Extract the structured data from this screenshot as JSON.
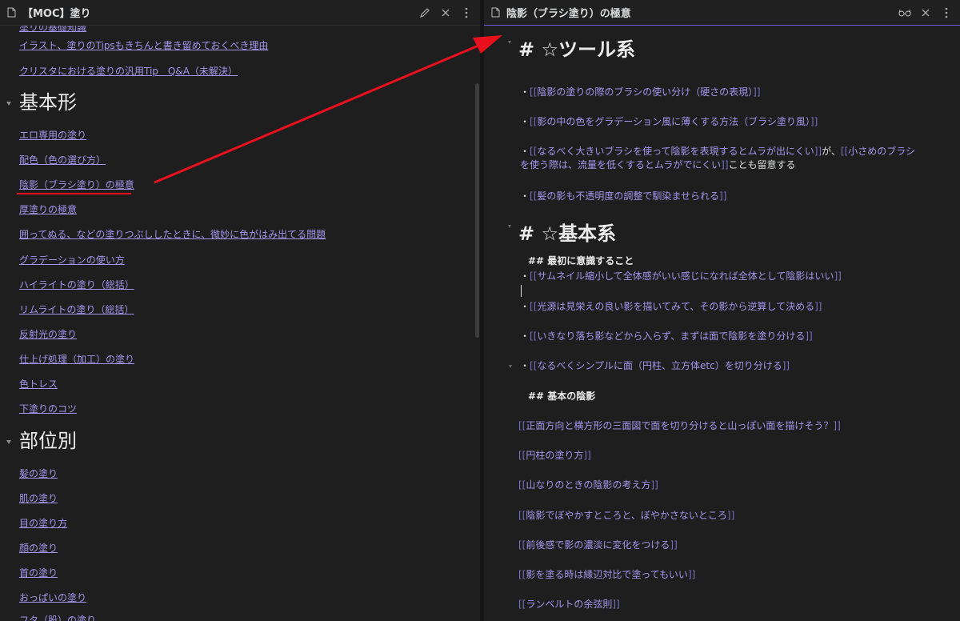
{
  "left_pane": {
    "title": "【MOC】塗り",
    "partial_top_link": "塗りの基礎知識",
    "intro_links": [
      "イラスト、塗りのTipsもきちんと書き留めておくべき理由",
      "クリスタにおける塗りの汎用Tip　Q&A（未解決）"
    ],
    "sections": [
      {
        "heading": "基本形",
        "links": [
          "エロ専用の塗り",
          "配色（色の選び方）",
          "陰影（ブラシ塗り）の極意",
          "厚塗りの極意",
          "囲ってぬる、などの塗りつぶししたときに、微妙に色がはみ出てる問題",
          "グラデーションの使い方",
          "ハイライトの塗り（総括）",
          "リムライトの塗り（総括）",
          "反射光の塗り",
          "仕上げ処理（加工）の塗り",
          "色トレス",
          "下塗りのコツ"
        ]
      },
      {
        "heading": "部位別",
        "links": [
          "髪の塗り",
          "肌の塗り",
          "目の塗り方",
          "顔の塗り",
          "首の塗り",
          "おっぱいの塗り",
          "フタ（股）の塗り"
        ]
      }
    ]
  },
  "right_pane": {
    "title": "陰影（ブラシ塗り）の極意",
    "h1_tools": "# ☆ツール系",
    "tool_items": [
      {
        "bullet": "・",
        "open": "[[",
        "link": "陰影の塗りの際のブラシの使い分け（硬さの表現）",
        "close": "]]"
      },
      {
        "bullet": "・",
        "open": "[[",
        "link": "影の中の色をグラデーション風に薄くする方法（ブラシ塗り風）",
        "close": "]]"
      },
      {
        "bullet": "・",
        "open": "[[",
        "link": "なるべく大きいブラシを使って陰影を表現するとムラが出にくい",
        "close": "]]",
        "mid": "が、",
        "open2": "[[",
        "link2": "小さめのブラシを使う際は、流量を低くするとムラがでにくい",
        "close2": "]]",
        "tail": "ことも留意する"
      },
      {
        "bullet": "・",
        "open": "[[",
        "link": "髪の影も不透明度の調整で馴染ませられる",
        "close": "]]"
      }
    ],
    "h1_basic": "# ☆基本系",
    "h2_first": "## 最初に意識すること",
    "basic_items": [
      {
        "bullet": "・",
        "open": "[[",
        "link": "サムネイル縮小して全体感がいい感じになれば全体として陰影はいい",
        "close": "]]"
      },
      {
        "bullet": "・",
        "open": "[[",
        "link": "光源は見栄えの良い影を描いてみて、その影から逆算して決める",
        "close": "]]"
      },
      {
        "bullet": "・",
        "open": "[[",
        "link": "いきなり落ち影などから入らず、まずは面で陰影を塗り分ける",
        "close": "]]"
      },
      {
        "bullet": "・",
        "open": "[[",
        "link": "なるべくシンプルに面（円柱、立方体etc）を切り分ける",
        "close": "]]"
      }
    ],
    "h2_shadow": "## 基本の陰影",
    "shadow_items": [
      {
        "open": "[[",
        "link": "正面方向と横方形の三面図で面を切り分けると山っぽい面を描けそう？",
        "close": "]]"
      },
      {
        "open": "[[",
        "link": "円柱の塗り方",
        "close": "]]"
      },
      {
        "open": "[[",
        "link": "山なりのときの陰影の考え方",
        "close": "]]"
      },
      {
        "open": "[[",
        "link": "陰影でぼやかすところと、ぼやかさないところ",
        "close": "]]"
      },
      {
        "open": "[[",
        "link": "前後感で影の濃淡に変化をつける",
        "close": "]]"
      },
      {
        "open": "[[",
        "link": "影を塗る時は縁辺対比で塗ってもいい",
        "close": "]]"
      },
      {
        "open": "[[",
        "link": "ランベルトの余弦則",
        "close": "]]"
      }
    ]
  },
  "colors": {
    "background": "#1e1e1e",
    "link": "#a496ee",
    "accent_border": "#6f5fe0",
    "annotation_red": "#e8101c"
  },
  "icons": {
    "left_header": [
      "document-icon",
      "edit-pencil-icon",
      "close-icon",
      "more-options-icon"
    ],
    "right_header": [
      "document-icon",
      "reading-glasses-icon",
      "close-icon",
      "more-options-icon"
    ]
  }
}
